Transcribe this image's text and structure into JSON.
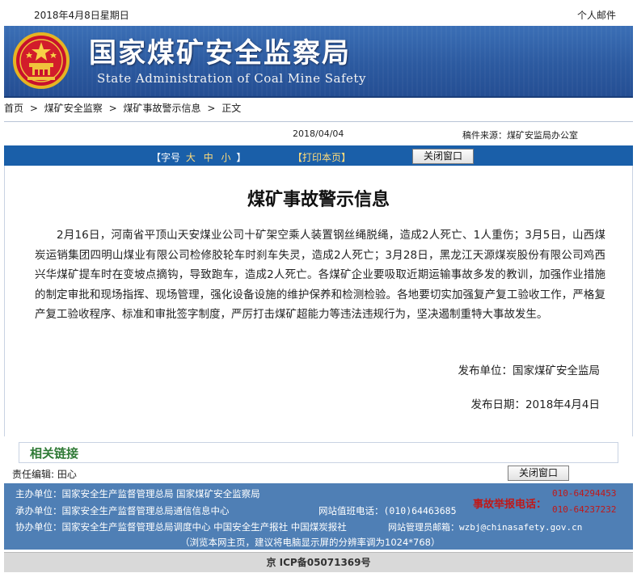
{
  "topbar": {
    "date": "2018年4月8日星期日",
    "personal_mail": "个人邮件"
  },
  "banner": {
    "title": "国家煤矿安全监察局",
    "subtitle": "State Administration of Coal Mine Safety"
  },
  "breadcrumb": {
    "items": [
      "首页",
      "煤矿安全监察",
      "煤矿事故警示信息",
      "正文"
    ],
    "separator": ">"
  },
  "info": {
    "date": "2018/04/04",
    "source": "稿件来源：煤矿安监局办公室"
  },
  "toolbar": {
    "font_label": "【字号",
    "size_large": "大",
    "size_medium": "中",
    "size_small": "小",
    "font_end": "】",
    "print": "【打印本页】",
    "close": "关闭窗口"
  },
  "article": {
    "title": "煤矿事故警示信息",
    "body": "2月16日，河南省平顶山天安煤业公司十矿架空乘人装置钢丝绳脱绳，造成2人死亡、1人重伤；3月5日，山西煤炭运销集团四明山煤业有限公司检修胶轮车时刹车失灵，造成2人死亡；3月28日，黑龙江天源煤炭股份有限公司鸡西兴华煤矿提车时在变坡点摘钩，导致跑车，造成2人死亡。各煤矿企业要吸取近期运输事故多发的教训，加强作业措施的制定审批和现场指挥、现场管理，强化设备设施的维护保养和检测检验。各地要切实加强复产复工验收工作，严格复产复工验收程序、标准和审批签字制度，严厉打击煤矿超能力等违法违规行为，坚决遏制重特大事故发生。",
    "publisher": "发布单位：国家煤矿安全监局",
    "publish_date": "发布日期：2018年4月4日"
  },
  "related": {
    "label": "相关链接"
  },
  "editor": {
    "text": "责任编辑: 田心",
    "close": "关闭窗口"
  },
  "footer": {
    "sponsor": "主办单位：国家安全生产监督管理总局  国家煤矿安全监察局",
    "organizer": "承办单位：国家安全生产监督管理总局通信信息中心",
    "duty_phone": "网站值班电话：(010)64463685",
    "cooperator": "协办单位：国家安全生产监督管理总局调度中心  中国安全生产报社  中国煤炭报社",
    "admin_email": "网站管理员邮箱：wzbj@chinasafety.gov.cn",
    "resolution_note": "（浏览本网主页，建议将电脑显示屏的分辨率调为1024*768）",
    "report_label": "事故举报电话：",
    "report_phones": [
      "010-64294453",
      "010-64237232"
    ]
  },
  "icp": {
    "text": "京 ICP备05071369号"
  },
  "colors": {
    "banner": "#2c5aa0",
    "toolbar": "#1a5fa9",
    "footer": "#4f7fb5",
    "report_red": "#c01818",
    "related_green": "#2f7a36"
  }
}
